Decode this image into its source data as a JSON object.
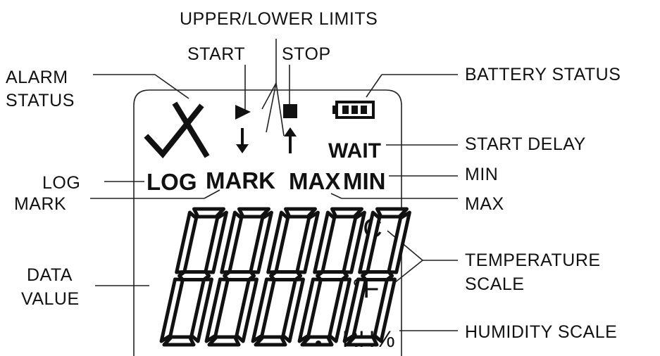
{
  "callouts": {
    "upper_lower_limits": "UPPER/LOWER LIMITS",
    "start": "START",
    "stop": "STOP",
    "alarm_status_line1": "ALARM",
    "alarm_status_line2": "STATUS",
    "battery_status": "BATTERY STATUS",
    "start_delay": "START DELAY",
    "min": "MIN",
    "max": "MAX",
    "log": "LOG",
    "mark": "MARK",
    "data_value_line1": "DATA",
    "data_value_line2": "VALUE",
    "temperature_scale_line1": "TEMPERATURE",
    "temperature_scale_line2": "SCALE",
    "humidity_scale": "HUMIDITY SCALE"
  },
  "lcd": {
    "wait": "WAIT",
    "log": "LOG",
    "mark": "MARK",
    "max": "MAX",
    "min": "MIN",
    "celsius": "°C",
    "fahrenheit": "°F",
    "rh": "RH%"
  },
  "icons": {
    "alarm": "alarm-check-x-icon",
    "start": "play-triangle-icon",
    "stop": "stop-square-icon",
    "lower_limit": "arrow-down-icon",
    "upper_limit": "arrow-up-icon",
    "battery": "battery-icon"
  }
}
